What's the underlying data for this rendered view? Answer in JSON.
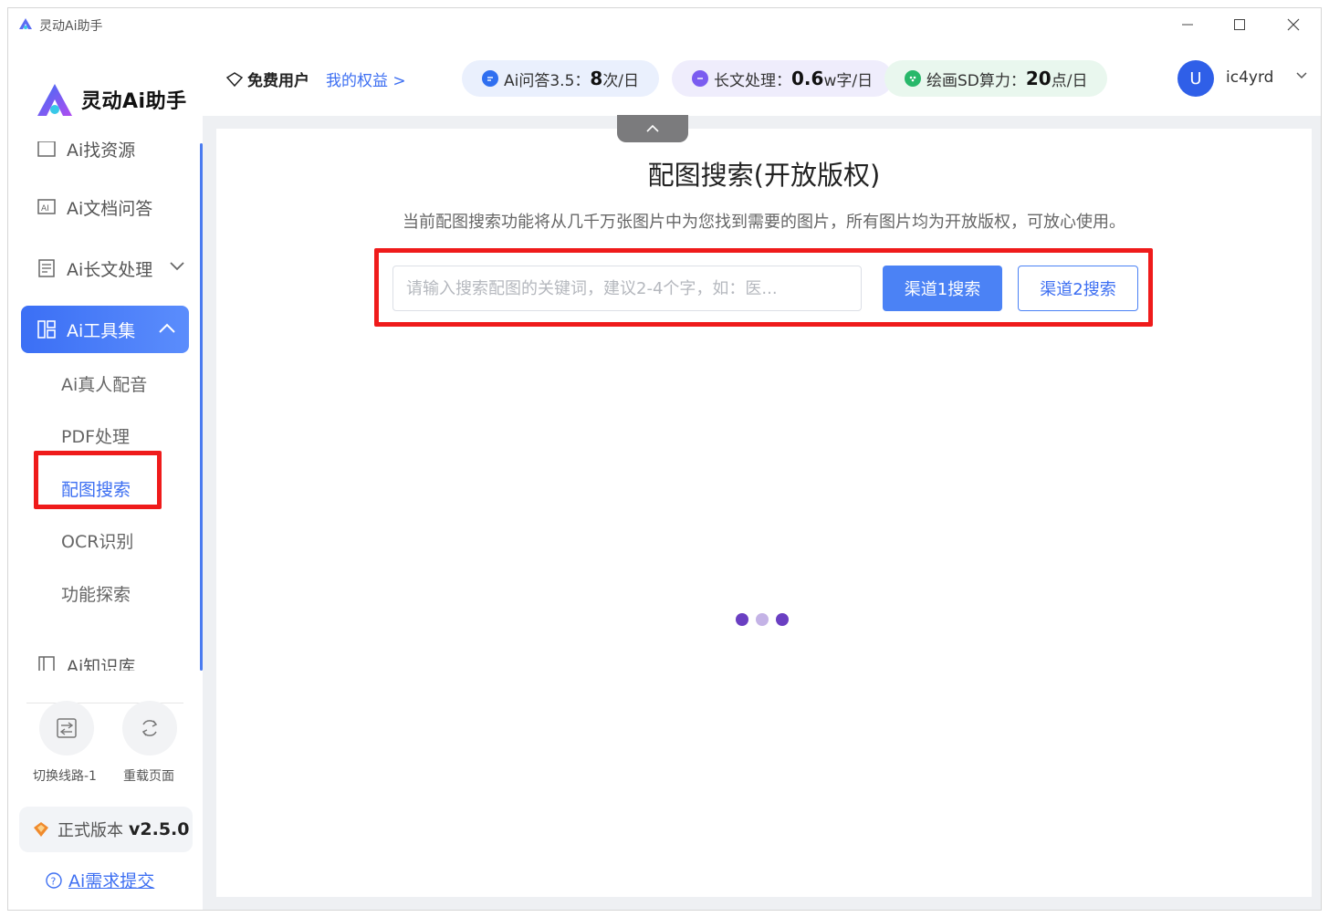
{
  "window": {
    "title": "灵动Ai助手"
  },
  "brand": {
    "name": "灵动Ai助手",
    "accent": "#3b6ff5"
  },
  "sidebar": {
    "partial_item": "Ai找资源",
    "items": [
      {
        "label": "Ai文档问答",
        "icon": "ai-document-icon"
      },
      {
        "label": "Ai长文处理",
        "icon": "long-text-icon"
      },
      {
        "label": "Ai工具集",
        "icon": "toolkit-grid-icon"
      },
      {
        "label": "Ai知识库",
        "icon": "knowledge-book-icon"
      }
    ],
    "sub_items": [
      "Ai真人配音",
      "PDF处理",
      "配图搜索",
      "OCR识别",
      "功能探索"
    ],
    "selected_sub_item": "配图搜索",
    "tools": [
      {
        "label": "切换线路-1",
        "icon": "switch-route-icon"
      },
      {
        "label": "重载页面",
        "icon": "reload-icon"
      }
    ],
    "version": {
      "label": "正式版本",
      "number": "v2.5.0"
    },
    "feedback": "Ai需求提交"
  },
  "header": {
    "user_type": "免费用户",
    "rights_link": "我的权益 >",
    "quotas": [
      {
        "label": "Ai问答3.5：",
        "value": "8",
        "unit": "次/日",
        "color": "#2f6ff0",
        "bg": "#eaf0fd"
      },
      {
        "label": "长文处理：",
        "value": "0.6",
        "unit": "w字/日",
        "color": "#7a5cf0",
        "bg": "#efedfc"
      },
      {
        "label": "绘画SD算力：",
        "value": "20",
        "unit": "点/日",
        "color": "#28b86a",
        "bg": "#e9f7ee"
      }
    ],
    "user": {
      "avatar_letter": "U",
      "name": "ic4yrd"
    }
  },
  "main": {
    "title": "配图搜索(开放版权)",
    "description": "当前配图搜索功能将从几千万张图片中为您找到需要的图片，所有图片均为开放版权，可放心使用。",
    "search_placeholder": "请输入搜索配图的关键词，建议2-4个字，如：医...",
    "search_value": "",
    "channel1_button": "渠道1搜索",
    "channel2_button": "渠道2搜索"
  },
  "loading": {
    "colors": [
      "#6a3fc2",
      "#c4b3e6",
      "#6a3fc2"
    ]
  }
}
